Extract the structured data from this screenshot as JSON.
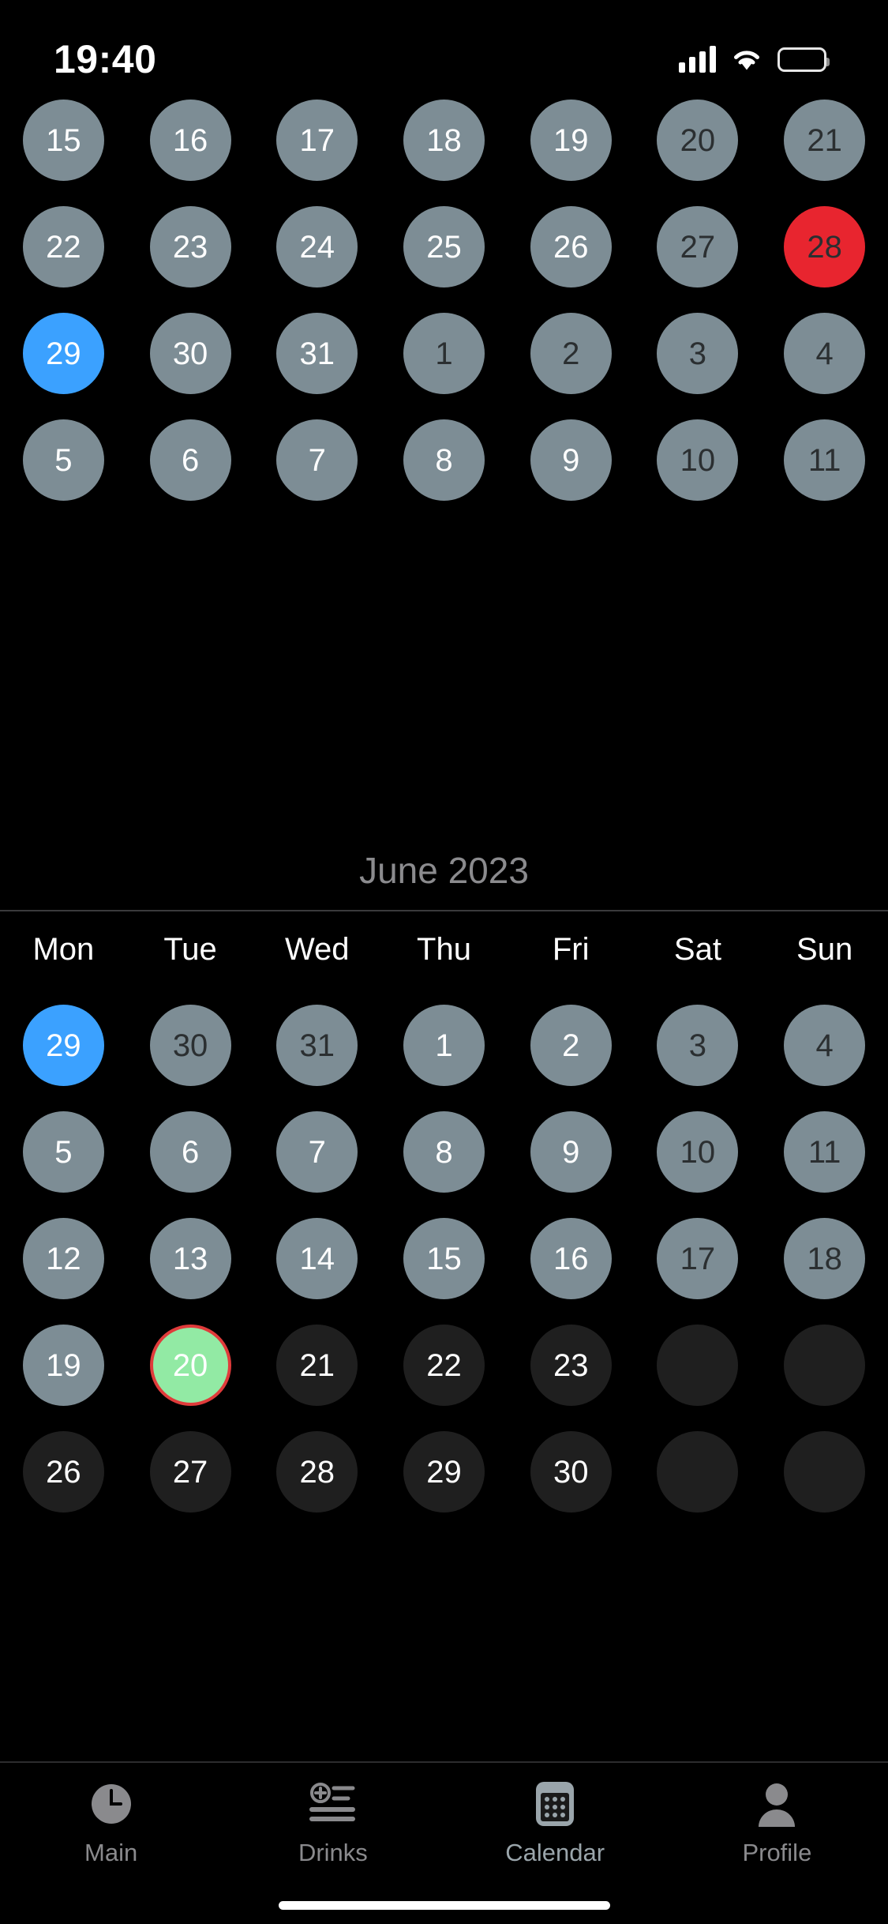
{
  "status_bar": {
    "time": "19:40",
    "cellular_icon": "cellular-signal-icon",
    "wifi_icon": "wifi-icon",
    "battery_icon": "battery-icon"
  },
  "top_month": {
    "label": "",
    "days": [
      {
        "n": "15",
        "style": "normal"
      },
      {
        "n": "16",
        "style": "normal"
      },
      {
        "n": "17",
        "style": "normal"
      },
      {
        "n": "18",
        "style": "normal"
      },
      {
        "n": "19",
        "style": "normal"
      },
      {
        "n": "20",
        "style": "dim"
      },
      {
        "n": "21",
        "style": "dim"
      },
      {
        "n": "22",
        "style": "normal"
      },
      {
        "n": "23",
        "style": "normal"
      },
      {
        "n": "24",
        "style": "normal"
      },
      {
        "n": "25",
        "style": "normal"
      },
      {
        "n": "26",
        "style": "normal"
      },
      {
        "n": "27",
        "style": "dim"
      },
      {
        "n": "28",
        "style": "red"
      },
      {
        "n": "29",
        "style": "blue"
      },
      {
        "n": "30",
        "style": "normal"
      },
      {
        "n": "31",
        "style": "normal"
      },
      {
        "n": "1",
        "style": "dim"
      },
      {
        "n": "2",
        "style": "dim"
      },
      {
        "n": "3",
        "style": "dim"
      },
      {
        "n": "4",
        "style": "dim"
      },
      {
        "n": "5",
        "style": "normal"
      },
      {
        "n": "6",
        "style": "normal"
      },
      {
        "n": "7",
        "style": "normal"
      },
      {
        "n": "8",
        "style": "normal"
      },
      {
        "n": "9",
        "style": "normal"
      },
      {
        "n": "10",
        "style": "dim"
      },
      {
        "n": "11",
        "style": "dim"
      }
    ]
  },
  "month_header": {
    "title": "June 2023",
    "weekdays": [
      "Mon",
      "Tue",
      "Wed",
      "Thu",
      "Fri",
      "Sat",
      "Sun"
    ]
  },
  "bottom_month": {
    "days": [
      {
        "n": "29",
        "style": "blue"
      },
      {
        "n": "30",
        "style": "dim"
      },
      {
        "n": "31",
        "style": "dim"
      },
      {
        "n": "1",
        "style": "normal"
      },
      {
        "n": "2",
        "style": "normal"
      },
      {
        "n": "3",
        "style": "dim"
      },
      {
        "n": "4",
        "style": "dim"
      },
      {
        "n": "5",
        "style": "normal"
      },
      {
        "n": "6",
        "style": "normal"
      },
      {
        "n": "7",
        "style": "normal"
      },
      {
        "n": "8",
        "style": "normal"
      },
      {
        "n": "9",
        "style": "normal"
      },
      {
        "n": "10",
        "style": "dim"
      },
      {
        "n": "11",
        "style": "dim"
      },
      {
        "n": "12",
        "style": "normal"
      },
      {
        "n": "13",
        "style": "normal"
      },
      {
        "n": "14",
        "style": "normal"
      },
      {
        "n": "15",
        "style": "normal"
      },
      {
        "n": "16",
        "style": "normal"
      },
      {
        "n": "17",
        "style": "dim"
      },
      {
        "n": "18",
        "style": "dim"
      },
      {
        "n": "19",
        "style": "normal"
      },
      {
        "n": "20",
        "style": "green"
      },
      {
        "n": "21",
        "style": "dark"
      },
      {
        "n": "22",
        "style": "dark"
      },
      {
        "n": "23",
        "style": "dark"
      },
      {
        "n": "",
        "style": "empty"
      },
      {
        "n": "",
        "style": "empty"
      },
      {
        "n": "26",
        "style": "dark"
      },
      {
        "n": "27",
        "style": "dark"
      },
      {
        "n": "28",
        "style": "dark"
      },
      {
        "n": "29",
        "style": "dark"
      },
      {
        "n": "30",
        "style": "dark"
      },
      {
        "n": "",
        "style": "empty"
      },
      {
        "n": "",
        "style": "empty"
      }
    ]
  },
  "tab_bar": {
    "tabs": [
      {
        "label": "Main",
        "icon": "clock-icon",
        "active": false
      },
      {
        "label": "Drinks",
        "icon": "add-to-list-icon",
        "active": false
      },
      {
        "label": "Calendar",
        "icon": "calendar-icon",
        "active": true
      },
      {
        "label": "Profile",
        "icon": "person-icon",
        "active": false
      }
    ]
  },
  "colors": {
    "background": "#000000",
    "day_default": "#7d8d95",
    "day_selected_blue": "#3ba1ff",
    "day_marked_red": "#e8252f",
    "day_today_green": "#92eaa4",
    "day_today_ring": "#e03b3b",
    "day_inactive_dark": "#1f1f1f",
    "month_label": "#8b8b8e",
    "tab_inactive": "#8a8a8d"
  }
}
